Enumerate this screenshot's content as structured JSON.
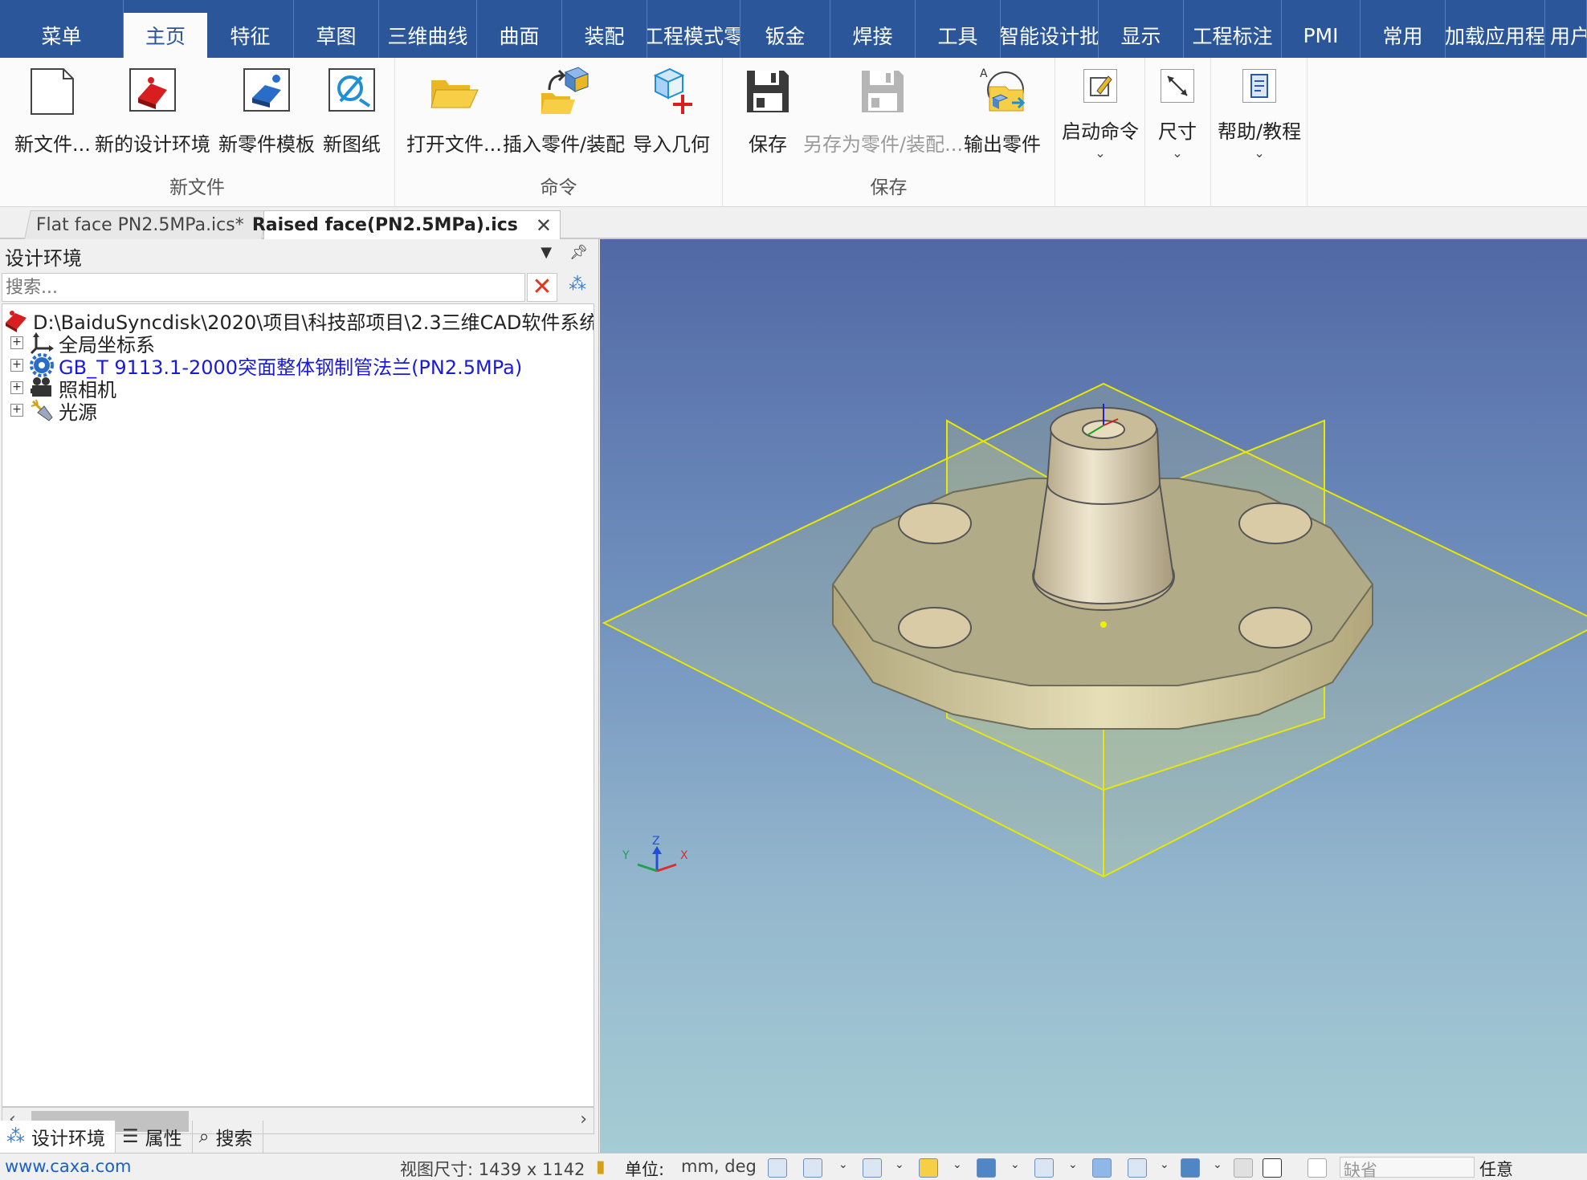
{
  "menu_tabs": [
    "菜单",
    "主页",
    "特征",
    "草图",
    "三维曲线",
    "曲面",
    "装配",
    "工程模式零",
    "钣金",
    "焊接",
    "工具",
    "智能设计批",
    "显示",
    "工程标注",
    "PMI",
    "常用",
    "加载应用程",
    "用户"
  ],
  "active_menu_tab": "主页",
  "ribbon": {
    "groups": [
      "新文件",
      "命令",
      "保存"
    ],
    "buttons": {
      "new_file": "新文件...",
      "new_design_env": "新的设计环境",
      "new_part_template": "新零件模板",
      "new_drawing": "新图纸",
      "open_file": "打开文件...",
      "insert_part": "插入零件/装配",
      "import_geometry": "导入几何",
      "save": "保存",
      "save_as_part": "另存为零件/装配...",
      "export_part": "输出零件",
      "launch_command": "启动命令",
      "dimension": "尺寸",
      "help": "帮助/教程"
    }
  },
  "doc_tabs": [
    "Flat face PN2.5MPa.ics*",
    "Raised face(PN2.5MPa).ics"
  ],
  "doc_close": "✕",
  "panel": {
    "title": "设计环境",
    "search_placeholder": "搜索...",
    "tree": {
      "root": "D:\\BaiduSyncdisk\\2020\\项目\\科技部项目\\2.3三维CAD软件系统",
      "items": [
        "全局坐标系",
        "GB_T 9113.1-2000突面整体钢制管法兰(PN2.5MPa)",
        "照相机",
        "光源"
      ]
    },
    "bottom_tabs": [
      "设计环境",
      "属性",
      "搜索"
    ]
  },
  "axis_labels": {
    "z": "Z",
    "y": "Y",
    "x": "X"
  },
  "status": {
    "website": "www.caxa.com",
    "view_size": "视图尺寸: 1439 x 1142",
    "units_label": "单位:",
    "units_value": "mm, deg",
    "filter_value": "缺省",
    "mode_value": "任意"
  },
  "colors": {
    "menu_bar": "#2b579a",
    "plane_outline": "#e8e800",
    "part": "#d8cdb0"
  }
}
